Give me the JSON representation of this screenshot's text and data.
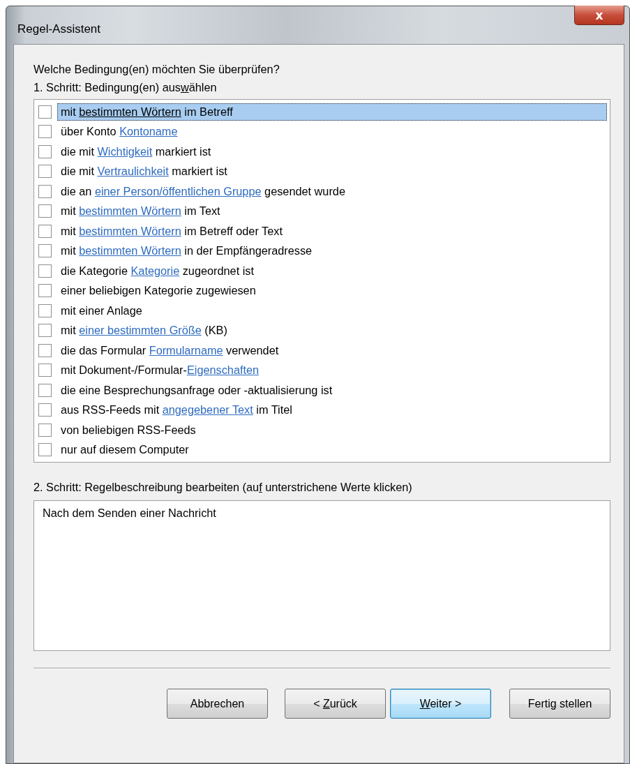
{
  "window": {
    "title": "Regel-Assistent",
    "close": "x"
  },
  "question": "Welche Bedingung(en) möchten Sie überprüfen?",
  "step1": {
    "before": "1. Schritt: Bedingung(en) aus",
    "key": "w",
    "after": "ählen"
  },
  "conditions": [
    {
      "checked": false,
      "selected": true,
      "parts": [
        {
          "text": "mit "
        },
        {
          "text": "bestimmten Wörtern",
          "link": true
        },
        {
          "text": " im Betreff"
        }
      ]
    },
    {
      "checked": false,
      "selected": false,
      "parts": [
        {
          "text": "über Konto "
        },
        {
          "text": "Kontoname",
          "link": true
        }
      ]
    },
    {
      "checked": false,
      "selected": false,
      "parts": [
        {
          "text": "die mit "
        },
        {
          "text": "Wichtigkeit",
          "link": true
        },
        {
          "text": " markiert ist"
        }
      ]
    },
    {
      "checked": false,
      "selected": false,
      "parts": [
        {
          "text": "die mit "
        },
        {
          "text": "Vertraulichkeit",
          "link": true
        },
        {
          "text": " markiert ist"
        }
      ]
    },
    {
      "checked": false,
      "selected": false,
      "parts": [
        {
          "text": "die an "
        },
        {
          "text": "einer Person/öffentlichen Gruppe",
          "link": true
        },
        {
          "text": " gesendet wurde"
        }
      ]
    },
    {
      "checked": false,
      "selected": false,
      "parts": [
        {
          "text": "mit "
        },
        {
          "text": "bestimmten Wörtern",
          "link": true
        },
        {
          "text": " im Text"
        }
      ]
    },
    {
      "checked": false,
      "selected": false,
      "parts": [
        {
          "text": "mit "
        },
        {
          "text": "bestimmten Wörtern",
          "link": true
        },
        {
          "text": " im Betreff oder Text"
        }
      ]
    },
    {
      "checked": false,
      "selected": false,
      "parts": [
        {
          "text": "mit "
        },
        {
          "text": "bestimmten Wörtern",
          "link": true
        },
        {
          "text": " in der Empfängeradresse"
        }
      ]
    },
    {
      "checked": false,
      "selected": false,
      "parts": [
        {
          "text": "die Kategorie "
        },
        {
          "text": "Kategorie",
          "link": true
        },
        {
          "text": " zugeordnet ist"
        }
      ]
    },
    {
      "checked": false,
      "selected": false,
      "parts": [
        {
          "text": "einer beliebigen Kategorie zugewiesen"
        }
      ]
    },
    {
      "checked": false,
      "selected": false,
      "parts": [
        {
          "text": "mit einer Anlage"
        }
      ]
    },
    {
      "checked": false,
      "selected": false,
      "parts": [
        {
          "text": "mit "
        },
        {
          "text": "einer bestimmten Größe",
          "link": true
        },
        {
          "text": " (KB)"
        }
      ]
    },
    {
      "checked": false,
      "selected": false,
      "parts": [
        {
          "text": "die das Formular "
        },
        {
          "text": "Formularname",
          "link": true
        },
        {
          "text": " verwendet"
        }
      ]
    },
    {
      "checked": false,
      "selected": false,
      "parts": [
        {
          "text": "mit Dokument-/Formular-"
        },
        {
          "text": "Eigenschaften",
          "link": true
        }
      ]
    },
    {
      "checked": false,
      "selected": false,
      "parts": [
        {
          "text": "die eine Besprechungsanfrage oder -aktualisierung ist"
        }
      ]
    },
    {
      "checked": false,
      "selected": false,
      "parts": [
        {
          "text": "aus RSS-Feeds mit "
        },
        {
          "text": "angegebener Text",
          "link": true
        },
        {
          "text": " im Titel"
        }
      ]
    },
    {
      "checked": false,
      "selected": false,
      "parts": [
        {
          "text": "von beliebigen RSS-Feeds"
        }
      ]
    },
    {
      "checked": false,
      "selected": false,
      "parts": [
        {
          "text": "nur auf diesem Computer"
        }
      ]
    }
  ],
  "step2": {
    "before": "2. Schritt: Regelbeschreibung bearbeiten (au",
    "key": "f",
    "after": " unterstrichene Werte klicken)"
  },
  "description": "Nach dem Senden einer Nachricht",
  "buttons": [
    {
      "before": "Abbrechen",
      "default": false
    },
    {
      "before": "< ",
      "key": "Z",
      "after": "urück",
      "default": false
    },
    {
      "key": "W",
      "after": "eiter >",
      "default": true
    },
    {
      "before": "Fertig stellen",
      "default": false
    }
  ]
}
